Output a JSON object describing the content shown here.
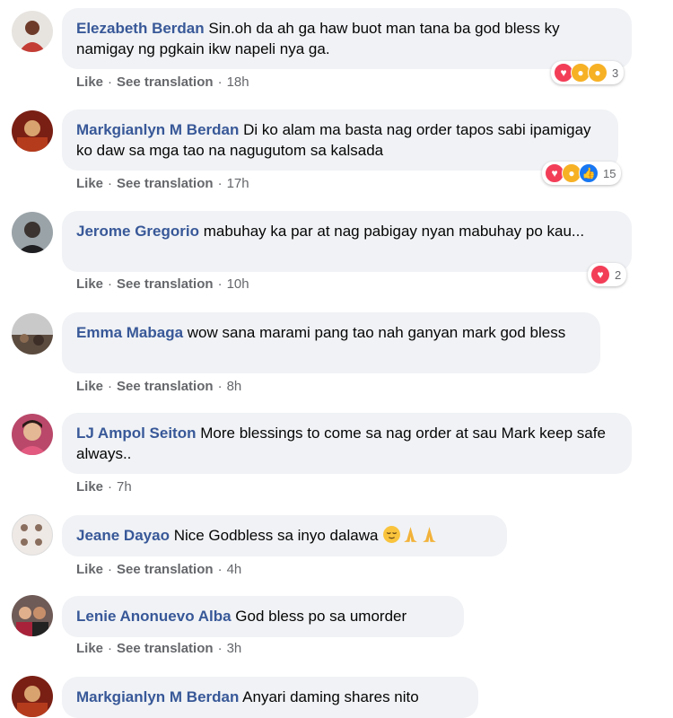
{
  "labels": {
    "like": "Like",
    "see_translation": "See translation",
    "sep": "·"
  },
  "comments": [
    {
      "author": "Elezabeth Berdan",
      "text": "Sin.oh da ah ga haw buot man tana ba god bless ky namigay ng pgkain ikw napeli nya ga.",
      "time": "18h",
      "reaction_count": "3",
      "reactions": [
        "love-icon",
        "wow-icon",
        "care-icon"
      ]
    },
    {
      "author": "Markgianlyn M Berdan",
      "text": "Di ko alam ma basta nag order tapos sabi ipamigay ko daw sa mga tao na nagugutom sa kalsada",
      "time": "17h",
      "reaction_count": "15",
      "reactions": [
        "love-icon",
        "care-icon",
        "like-icon"
      ]
    },
    {
      "author": "Jerome Gregorio",
      "text": "mabuhay ka par at nag pabigay nyan mabuhay po kau...",
      "time": "10h",
      "reaction_count": "2",
      "reactions": [
        "love-icon"
      ]
    },
    {
      "author": "Emma Mabaga",
      "text": "wow sana marami pang tao nah ganyan mark god bless",
      "time": "8h"
    },
    {
      "author": "LJ Ampol Seiton",
      "text": "More blessings to come sa nag order at sau Mark keep safe always..",
      "time": "7h"
    },
    {
      "author": "Jeane Dayao",
      "text": "Nice Godbless sa inyo dalawa",
      "time": "4h",
      "emojis": [
        "relieved-face-icon",
        "folded-hands-icon",
        "folded-hands-icon"
      ]
    },
    {
      "author": "Lenie Anonuevo Alba",
      "text": "God bless po sa umorder",
      "time": "3h"
    },
    {
      "author": "Markgianlyn M Berdan",
      "text": "Anyari daming shares nito"
    }
  ]
}
